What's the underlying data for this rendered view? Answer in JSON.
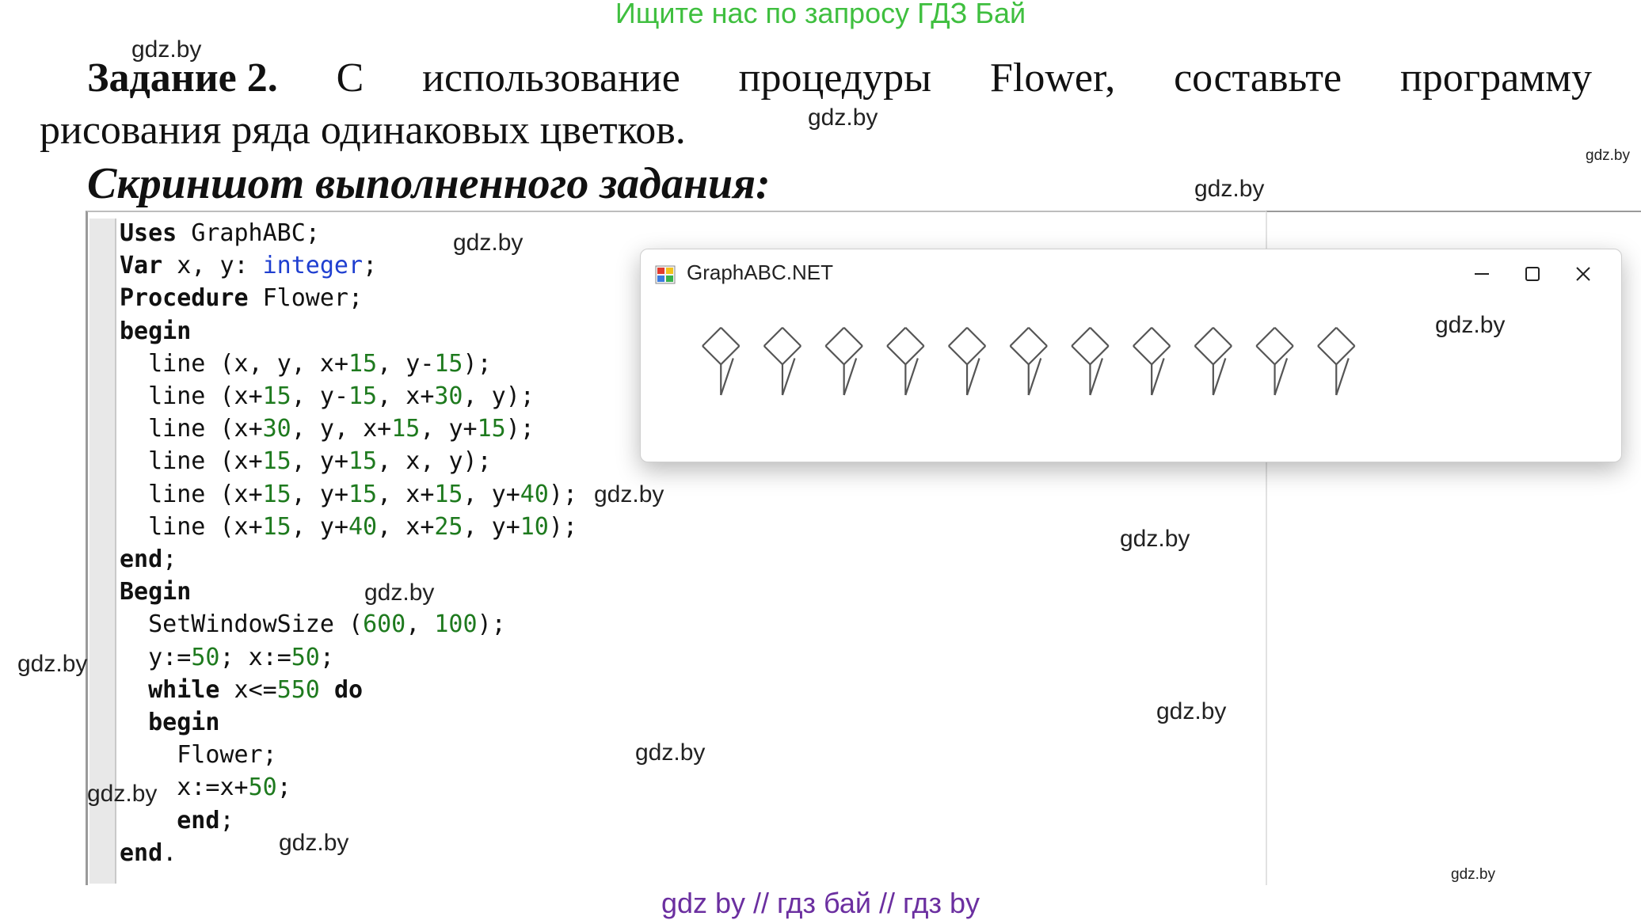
{
  "banner": "Ищите нас по запросу ГДЗ Бай",
  "task": {
    "heading": "Задание 2.",
    "words": [
      "С",
      "использование",
      "процедуры",
      "Flower,",
      "составьте",
      "программу"
    ],
    "line2": "рисования ряда одинаковых цветков."
  },
  "subtitle": "Скриншот выполненного задания:",
  "code": [
    {
      "t": "Uses GraphABC;"
    },
    {
      "t": "Var x, y: integer;"
    },
    {
      "t": "Procedure Flower;"
    },
    {
      "t": "begin"
    },
    {
      "t": "  line (x, y, x+15, y-15);"
    },
    {
      "t": "  line (x+15, y-15, x+30, y);"
    },
    {
      "t": "  line (x+30, y, x+15, y+15);"
    },
    {
      "t": "  line (x+15, y+15, x, y);"
    },
    {
      "t": "  line (x+15, y+15, x+15, y+40);"
    },
    {
      "t": "  line (x+15, y+40, x+25, y+10);"
    },
    {
      "t": "end;"
    },
    {
      "t": "Begin"
    },
    {
      "t": "  SetWindowSize (600, 100);"
    },
    {
      "t": "  y:=50; x:=50;"
    },
    {
      "t": "  while x<=550 do"
    },
    {
      "t": "  begin"
    },
    {
      "t": "    Flower;"
    },
    {
      "t": "    x:=x+50;"
    },
    {
      "t": "    end;"
    },
    {
      "t": "end."
    }
  ],
  "colors": {
    "keyword": "#111111",
    "type": "#1f3fd0",
    "number": "#1e7a1e",
    "banner": "#3fbf3f",
    "footer": "#6b2fa0"
  },
  "window": {
    "title": "GraphABC.NET",
    "minimize_icon": "minimize-icon",
    "maximize_icon": "maximize-icon",
    "close_icon": "close-icon",
    "flower_count": 11
  },
  "watermarks": [
    "gdz.by",
    "gdz.by",
    "gdz.by",
    "gdz.by",
    "gdz.by",
    "gdz.by",
    "gdz.by",
    "gdz.by",
    "gdz.by",
    "gdz.by",
    "gdz.by",
    "gdz.by",
    "gdz.by",
    "gdz.by"
  ],
  "footer": "gdz by  //  гдз бай  //  гдз by"
}
